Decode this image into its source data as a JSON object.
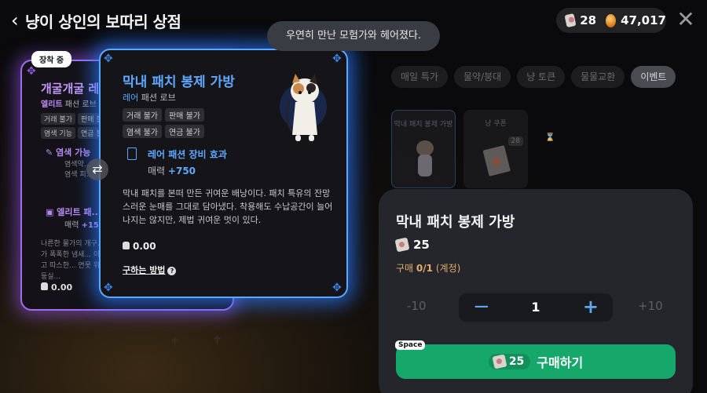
{
  "header": {
    "title": "냥이 상인의 보따리 상점",
    "tickets": "28",
    "coins": "47,017"
  },
  "toast": "우연히 만난 모험가와 헤어졌다.",
  "tabs": [
    "매일 특가",
    "물약/붕대",
    "냥 토큰",
    "물물교환",
    "이벤트"
  ],
  "shop_items": [
    {
      "name": "막내 패치 봉제 가방"
    },
    {
      "name": "냥 쿠폰",
      "badge": "28"
    }
  ],
  "equipped_card": {
    "badge": "장착 중",
    "name": "개굴개굴 레...",
    "grade": "엘리트",
    "type": "패션 로브",
    "tags": [
      "거래 불가",
      "판매 불...",
      "염색 기능",
      "연금 불..."
    ],
    "dye_title": "염색 가능",
    "dye_sub": [
      "염색약...",
      "염색 피..."
    ],
    "elite_title": "엘리트 패...",
    "elite_stat_name": "매력",
    "elite_stat_value": "+150",
    "desc": "나른한 물가의 개구... 어딘가 폭폭한 냄새... 이걸 메고 따스한... 연못 위를 두둥실...",
    "weight": "0.00"
  },
  "item_card": {
    "name": "막내 패치 봉제 가방",
    "grade": "레어",
    "type": "패션 로브",
    "tags": [
      "거래 불가",
      "판매 불가",
      "염색 불가",
      "연금 불가"
    ],
    "effect_title": "레어 패션 장비 효과",
    "stat_name": "매력",
    "stat_value": "+750",
    "desc": "막내 패치를 본떠 만든 귀여운 배낭이다. 패치 특유의 잔망스러운 눈매를 그대로 담아냈다. 착용해도 수납공간이 늘어나지는 않지만, 제법 귀여운 멋이 있다.",
    "weight": "0.00",
    "how_to_get": "구하는 방법"
  },
  "purchase": {
    "name": "막내 패치 봉제 가방",
    "price": "25",
    "limit_label": "구매",
    "limit_value": "0/1",
    "limit_note": "(계정)",
    "minus10": "-10",
    "quantity": "1",
    "plus10": "+10",
    "buy_label": "구매하기",
    "buy_cost": "25",
    "key_hint": "Space"
  },
  "colors": {
    "rare_blue": "#5fa8ff",
    "elite_purple": "#b58af0",
    "buy_green": "#16a86a"
  }
}
